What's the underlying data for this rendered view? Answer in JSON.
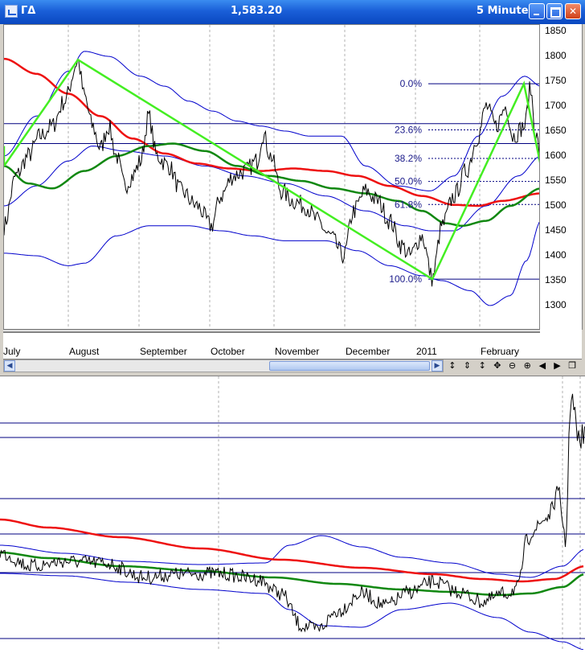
{
  "titlebar": {
    "symbol": "ΓΔ",
    "price": "1,583.20",
    "interval": "5 Minute"
  },
  "y_axis": [
    "1850",
    "1800",
    "1750",
    "1700",
    "1650",
    "1600",
    "1550",
    "1500",
    "1450",
    "1400",
    "1350",
    "1300"
  ],
  "x_axis": [
    "July",
    "August",
    "September",
    "October",
    "November",
    "December",
    "2011",
    "February"
  ],
  "fibonacci": [
    "0.0%",
    "23.6%",
    "38.2%",
    "50.0%",
    "61.8%",
    "100.0%"
  ],
  "icons": {
    "minimize": "minimize-icon",
    "maximize": "maximize-icon",
    "close": "close-icon",
    "scroll_left": "arrow-left-icon",
    "scroll_right": "arrow-right-icon"
  },
  "toolbar_glyphs": {
    "auto_scale": "↕",
    "scroll_page": "⇕",
    "move": "✥",
    "move_vertical": "↕",
    "zoom_out": "⊖",
    "zoom_in": "⊕",
    "prev": "◀",
    "next": "▶",
    "restore": "❐"
  },
  "colors": {
    "price": "#000000",
    "band": "#0000cc",
    "ma_red": "#ee1111",
    "ma_green": "#118811",
    "trend": "#44ee22",
    "gridline": "#000080"
  }
}
